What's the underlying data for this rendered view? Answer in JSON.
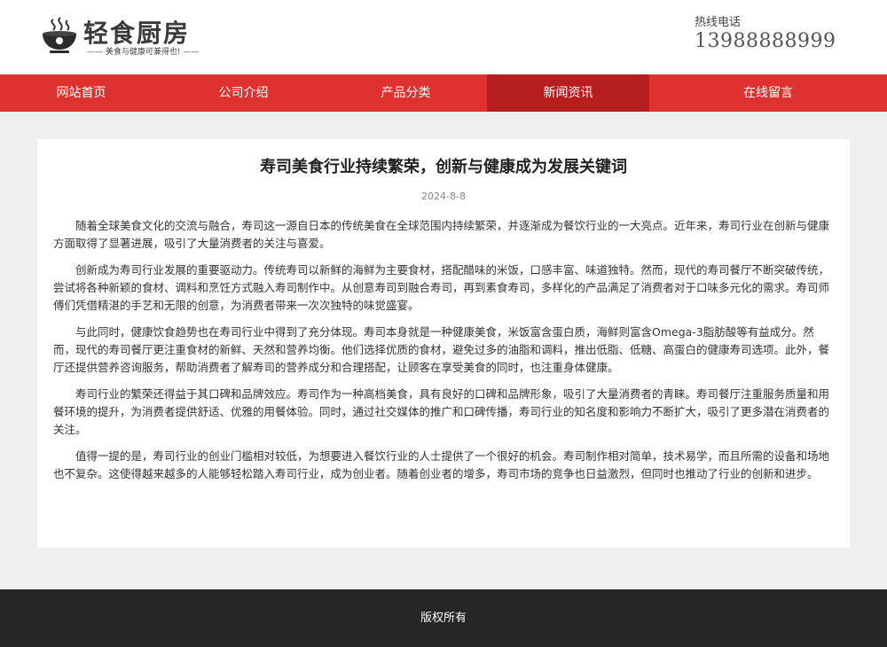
{
  "header": {
    "logo_title": "轻食厨房",
    "logo_slogan": "—— 美食与健康可兼得也! ——",
    "hotline_label": "热线电话",
    "hotline_number": "13988888999"
  },
  "nav": {
    "items": [
      {
        "label": "网站首页"
      },
      {
        "label": "公司介绍"
      },
      {
        "label": "产品分类"
      },
      {
        "label": "新闻资讯"
      },
      {
        "label": "在线留言"
      }
    ],
    "active_index": 3
  },
  "article": {
    "title": "寿司美食行业持续繁荣，创新与健康成为发展关键词",
    "date": "2024-8-8",
    "paragraphs": [
      "随着全球美食文化的交流与融合，寿司这一源自日本的传统美食在全球范围内持续繁荣，并逐渐成为餐饮行业的一大亮点。近年来，寿司行业在创新与健康方面取得了显著进展，吸引了大量消费者的关注与喜爱。",
      "创新成为寿司行业发展的重要驱动力。传统寿司以新鲜的海鲜为主要食材，搭配醋味的米饭，口感丰富、味道独特。然而，现代的寿司餐厅不断突破传统，尝试将各种新颖的食材、调料和烹饪方式融入寿司制作中。从创意寿司到融合寿司，再到素食寿司，多样化的产品满足了消费者对于口味多元化的需求。寿司师傅们凭借精湛的手艺和无限的创意，为消费者带来一次次独特的味觉盛宴。",
      "与此同时，健康饮食趋势也在寿司行业中得到了充分体现。寿司本身就是一种健康美食，米饭富含蛋白质，海鲜则富含Omega-3脂肪酸等有益成分。然而，现代的寿司餐厅更注重食材的新鲜、天然和营养均衡。他们选择优质的食材，避免过多的油脂和调料，推出低脂、低糖、高蛋白的健康寿司选项。此外，餐厅还提供营养咨询服务，帮助消费者了解寿司的营养成分和合理搭配，让顾客在享受美食的同时，也注重身体健康。",
      "寿司行业的繁荣还得益于其口碑和品牌效应。寿司作为一种高档美食，具有良好的口碑和品牌形象，吸引了大量消费者的青睐。寿司餐厅注重服务质量和用餐环境的提升，为消费者提供舒适、优雅的用餐体验。同时，通过社交媒体的推广和口碑传播，寿司行业的知名度和影响力不断扩大，吸引了更多潜在消费者的关注。",
      "值得一提的是，寿司行业的创业门槛相对较低，为想要进入餐饮行业的人士提供了一个很好的机会。寿司制作相对简单，技术易学，而且所需的设备和场地也不复杂。这使得越来越多的人能够轻松踏入寿司行业，成为创业者。随着创业者的增多，寿司市场的竞争也日益激烈，但同时也推动了行业的创新和进步。"
    ]
  },
  "footer": {
    "copyright": "版权所有"
  },
  "colors": {
    "nav_bg": "#e03131",
    "nav_active_bg": "#b71e1e",
    "footer_bg": "#262626",
    "page_bg": "#efefef"
  }
}
